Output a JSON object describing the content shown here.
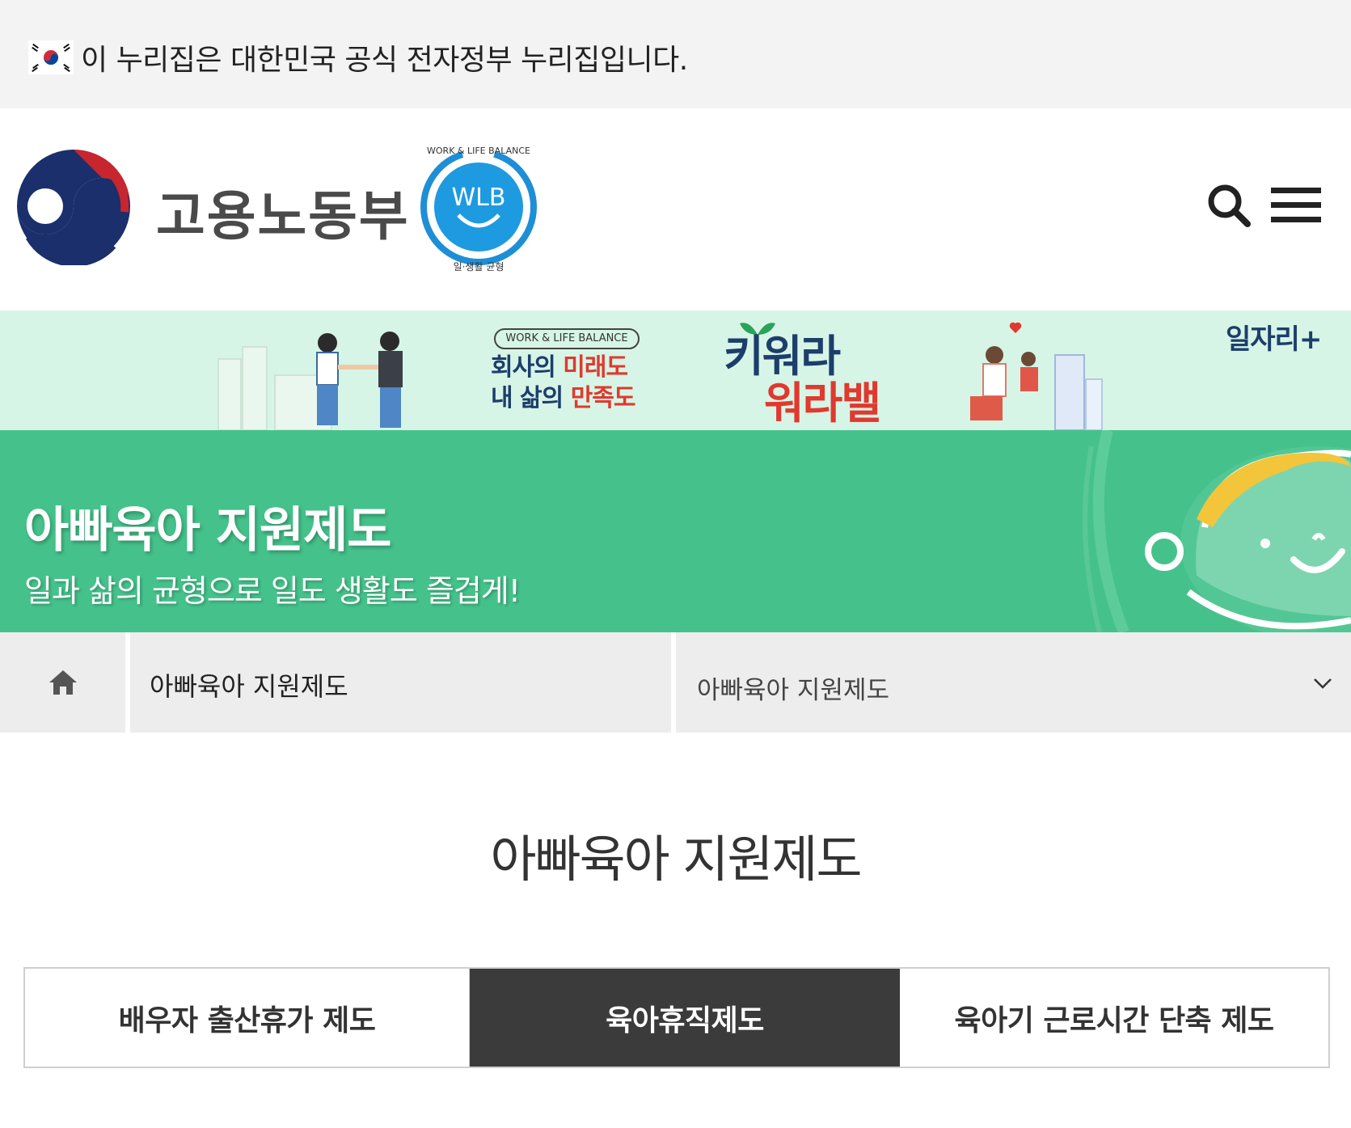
{
  "gov_notice": {
    "text": "이 누리집은 대한민국 공식 전자정부 누리집입니다."
  },
  "header": {
    "ministry_name": "고용노동부",
    "wlb_badge": {
      "ring_text_top": "WORK & LIFE BALANCE",
      "center_text": "WLB",
      "ring_text_bottom": "일·생활 균형"
    },
    "icons": {
      "search": "search-icon",
      "menu": "hamburger-menu-icon"
    }
  },
  "campaign_banner": {
    "tag": "WORK & LIFE BALANCE",
    "slogan_line1_a": "회사의 ",
    "slogan_line1_b": "미래도",
    "slogan_line2_a": "내 삶의 ",
    "slogan_line2_b": "만족도",
    "brand_line1": "키워라",
    "brand_line2": "워라밸",
    "jobs_logo": "일자리+"
  },
  "hero": {
    "title": "아빠육아 지원제도",
    "subtitle": "일과 삶의 균형으로 일도 생활도 즐겁게!",
    "bg_color": "#45c28b"
  },
  "breadcrumb": {
    "home_icon": "home-icon",
    "level1": "아빠육아 지원제도",
    "level2": "아빠육아 지원제도"
  },
  "main": {
    "page_title": "아빠육아 지원제도",
    "tabs": [
      {
        "label": "배우자 출산휴가 제도",
        "active": false
      },
      {
        "label": "육아휴직제도",
        "active": true
      },
      {
        "label": "육아기 근로시간 단축 제도",
        "active": false
      }
    ]
  }
}
